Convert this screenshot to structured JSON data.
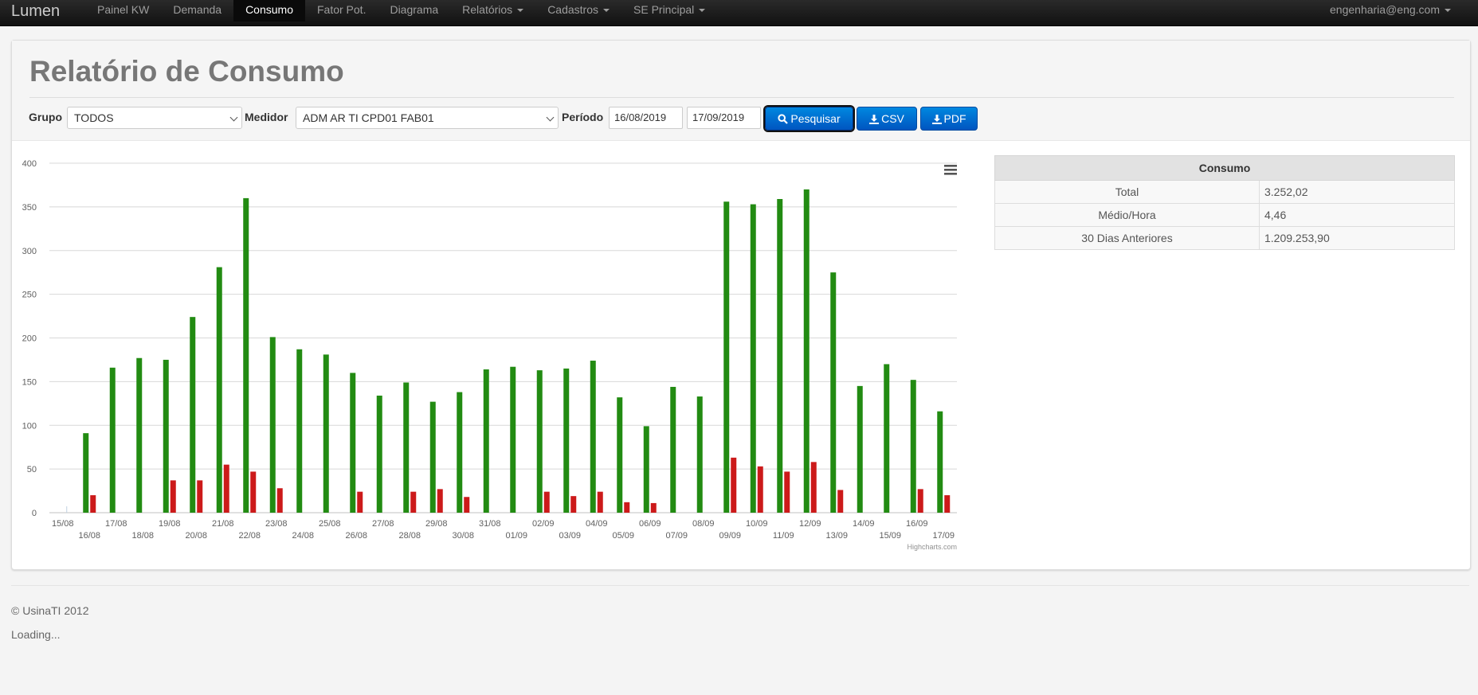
{
  "navbar": {
    "brand": "Lumen",
    "items": [
      {
        "label": "Painel KW"
      },
      {
        "label": "Demanda"
      },
      {
        "label": "Consumo"
      },
      {
        "label": "Fator Pot."
      },
      {
        "label": "Diagrama"
      },
      {
        "label": "Relatórios"
      },
      {
        "label": "Cadastros"
      },
      {
        "label": "SE Principal"
      }
    ],
    "active_item": "Consumo",
    "user": "engenharia@eng.com"
  },
  "page": {
    "title": "Relatório de Consumo"
  },
  "filters": {
    "grupo_label": "Grupo",
    "grupo_value": "TODOS",
    "medidor_label": "Medidor",
    "medidor_value": "ADM AR TI CPD01 FAB01",
    "periodo_label": "Período",
    "date_start": "16/08/2019",
    "date_end": "17/09/2019",
    "search_label": "Pesquisar",
    "csv_label": "CSV",
    "pdf_label": "PDF"
  },
  "colors": {
    "green_series": "#228b12",
    "red_series": "#cc1a1a",
    "button_blue": "#0066d0",
    "navbar": "#1b1b1b"
  },
  "chart_data": {
    "type": "bar",
    "categories": [
      "15/08",
      "16/08",
      "17/08",
      "18/08",
      "19/08",
      "20/08",
      "21/08",
      "22/08",
      "23/08",
      "24/08",
      "25/08",
      "26/08",
      "27/08",
      "28/08",
      "29/08",
      "30/08",
      "31/08",
      "01/09",
      "02/09",
      "03/09",
      "04/09",
      "05/09",
      "06/09",
      "07/09",
      "08/09",
      "09/09",
      "10/09",
      "11/09",
      "12/09",
      "13/09",
      "14/09",
      "15/09",
      "16/09",
      "17/09"
    ],
    "series": [
      {
        "color": "#228b12",
        "values": [
          0,
          91,
          166,
          177,
          175,
          224,
          281,
          360,
          201,
          187,
          181,
          160,
          134,
          149,
          127,
          138,
          164,
          167,
          163,
          165,
          174,
          132,
          99,
          144,
          133,
          356,
          353,
          359,
          370,
          275,
          145,
          170,
          152,
          116
        ]
      },
      {
        "color": "#cc1a1a",
        "values": [
          0,
          20,
          0,
          0,
          37,
          37,
          55,
          47,
          28,
          0,
          0,
          24,
          0,
          24,
          27,
          18,
          0,
          0,
          24,
          19,
          24,
          12,
          11,
          0,
          0,
          63,
          53,
          47,
          58,
          26,
          0,
          0,
          27,
          20
        ]
      }
    ],
    "yticks": [
      "0",
      "50",
      "100",
      "150",
      "200",
      "250",
      "300",
      "350",
      "400"
    ],
    "ylim": [
      0,
      400
    ],
    "grid": true,
    "legend": "none",
    "credit": "Highcharts.com"
  },
  "consumo_table": {
    "header": "Consumo",
    "rows": [
      {
        "label": "Total",
        "value": "3.252,02"
      },
      {
        "label": "Médio/Hora",
        "value": "4,46"
      },
      {
        "label": "30 Dias Anteriores",
        "value": "1.209.253,90"
      }
    ]
  },
  "footer": {
    "copyright": "© UsinaTI 2012",
    "loading": "Loading..."
  }
}
